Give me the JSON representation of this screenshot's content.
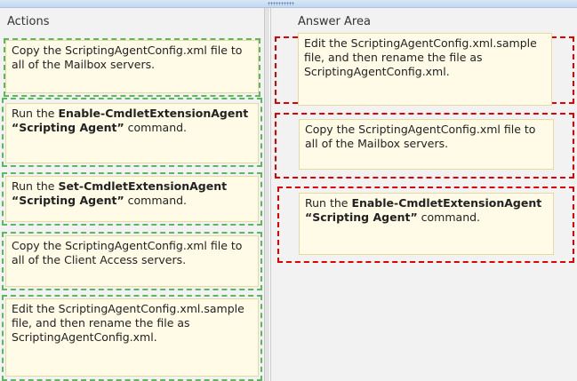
{
  "actions": {
    "title": "Actions",
    "items": [
      {
        "pre": "Copy the ScriptingAgentConfig.xml file to all of the Mailbox servers.",
        "bold": "",
        "post": ""
      },
      {
        "pre": "Run the ",
        "bold": "Enable-CmdletExtensionAgent “Scripting Agent”",
        "post": " command."
      },
      {
        "pre": "Run the ",
        "bold": "Set-CmdletExtensionAgent “Scripting Agent”",
        "post": " command."
      },
      {
        "pre": "Copy the ScriptingAgentConfig.xml file to all of the Client Access servers.",
        "bold": "",
        "post": ""
      },
      {
        "pre": "Edit the ScriptingAgentConfig.xml.sample file, and then rename the file as ScriptingAgentConfig.xml.",
        "bold": "",
        "post": ""
      }
    ]
  },
  "answer": {
    "title": "Answer Area",
    "items": [
      {
        "pre": "Edit the ScriptingAgentConfig.xml.sample file, and then rename the file as ScriptingAgentConfig.xml.",
        "bold": "",
        "post": ""
      },
      {
        "pre": "Copy the ScriptingAgentConfig.xml file to all of the Mailbox servers.",
        "bold": "",
        "post": ""
      },
      {
        "pre": "Run the ",
        "bold": "Enable-CmdletExtensionAgent “Scripting Agent”",
        "post": " command."
      }
    ]
  },
  "colors": {
    "card_bg": "#fffbe6",
    "action_border": "#5cb85c",
    "answer_border": "#e00000",
    "panel_bg": "#f2f2f2"
  }
}
